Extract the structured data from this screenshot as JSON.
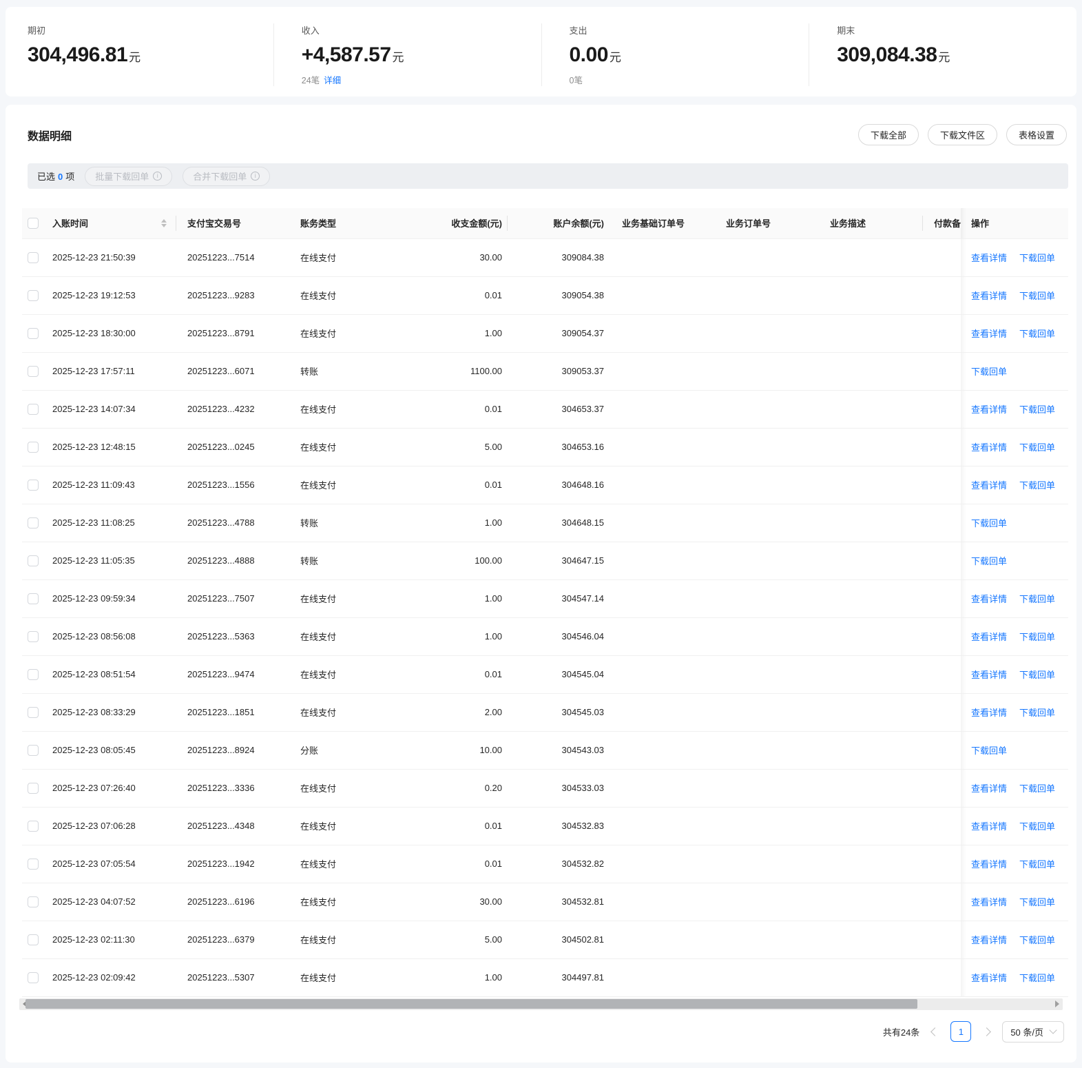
{
  "accent_color": "#1677ff",
  "summary": {
    "cards": [
      {
        "label": "期初",
        "value": "304,496.81",
        "unit": "元",
        "sub": "",
        "sub_link": ""
      },
      {
        "label": "收入",
        "value": "+4,587.57",
        "unit": "元",
        "sub": "24笔",
        "sub_link": "详细"
      },
      {
        "label": "支出",
        "value": "0.00",
        "unit": "元",
        "sub": "0笔",
        "sub_link": ""
      },
      {
        "label": "期末",
        "value": "309,084.38",
        "unit": "元",
        "sub": "",
        "sub_link": ""
      }
    ]
  },
  "panel": {
    "title": "数据明细",
    "buttons": {
      "download_all": "下载全部",
      "download_zone": "下载文件区",
      "table_settings": "表格设置"
    },
    "selection": {
      "prefix": "已选",
      "count": "0",
      "suffix": "项",
      "batch_download": "批量下载回单",
      "merge_download": "合并下载回单"
    }
  },
  "table": {
    "columns": [
      "入账时间",
      "支付宝交易号",
      "账务类型",
      "收支金额(元)",
      "账户余额(元)",
      "业务基础订单号",
      "业务订单号",
      "业务描述",
      "付款备",
      "操作"
    ],
    "actions": {
      "view": "查看详情",
      "download": "下载回单"
    },
    "rows": [
      {
        "time": "2025-12-23 21:50:39",
        "txn": "20251223...7514",
        "type": "在线支付",
        "amount": "30.00",
        "balance": "309084.38",
        "has_view": true
      },
      {
        "time": "2025-12-23 19:12:53",
        "txn": "20251223...9283",
        "type": "在线支付",
        "amount": "0.01",
        "balance": "309054.38",
        "has_view": true
      },
      {
        "time": "2025-12-23 18:30:00",
        "txn": "20251223...8791",
        "type": "在线支付",
        "amount": "1.00",
        "balance": "309054.37",
        "has_view": true
      },
      {
        "time": "2025-12-23 17:57:11",
        "txn": "20251223...6071",
        "type": "转账",
        "amount": "1100.00",
        "balance": "309053.37",
        "has_view": false
      },
      {
        "time": "2025-12-23 14:07:34",
        "txn": "20251223...4232",
        "type": "在线支付",
        "amount": "0.01",
        "balance": "304653.37",
        "has_view": true
      },
      {
        "time": "2025-12-23 12:48:15",
        "txn": "20251223...0245",
        "type": "在线支付",
        "amount": "5.00",
        "balance": "304653.16",
        "has_view": true
      },
      {
        "time": "2025-12-23 11:09:43",
        "txn": "20251223...1556",
        "type": "在线支付",
        "amount": "0.01",
        "balance": "304648.16",
        "has_view": true
      },
      {
        "time": "2025-12-23 11:08:25",
        "txn": "20251223...4788",
        "type": "转账",
        "amount": "1.00",
        "balance": "304648.15",
        "has_view": false
      },
      {
        "time": "2025-12-23 11:05:35",
        "txn": "20251223...4888",
        "type": "转账",
        "amount": "100.00",
        "balance": "304647.15",
        "has_view": false
      },
      {
        "time": "2025-12-23 09:59:34",
        "txn": "20251223...7507",
        "type": "在线支付",
        "amount": "1.00",
        "balance": "304547.14",
        "has_view": true
      },
      {
        "time": "2025-12-23 08:56:08",
        "txn": "20251223...5363",
        "type": "在线支付",
        "amount": "1.00",
        "balance": "304546.04",
        "has_view": true
      },
      {
        "time": "2025-12-23 08:51:54",
        "txn": "20251223...9474",
        "type": "在线支付",
        "amount": "0.01",
        "balance": "304545.04",
        "has_view": true
      },
      {
        "time": "2025-12-23 08:33:29",
        "txn": "20251223...1851",
        "type": "在线支付",
        "amount": "2.00",
        "balance": "304545.03",
        "has_view": true
      },
      {
        "time": "2025-12-23 08:05:45",
        "txn": "20251223...8924",
        "type": "分账",
        "amount": "10.00",
        "balance": "304543.03",
        "has_view": false
      },
      {
        "time": "2025-12-23 07:26:40",
        "txn": "20251223...3336",
        "type": "在线支付",
        "amount": "0.20",
        "balance": "304533.03",
        "has_view": true
      },
      {
        "time": "2025-12-23 07:06:28",
        "txn": "20251223...4348",
        "type": "在线支付",
        "amount": "0.01",
        "balance": "304532.83",
        "has_view": true
      },
      {
        "time": "2025-12-23 07:05:54",
        "txn": "20251223...1942",
        "type": "在线支付",
        "amount": "0.01",
        "balance": "304532.82",
        "has_view": true
      },
      {
        "time": "2025-12-23 04:07:52",
        "txn": "20251223...6196",
        "type": "在线支付",
        "amount": "30.00",
        "balance": "304532.81",
        "has_view": true
      },
      {
        "time": "2025-12-23 02:11:30",
        "txn": "20251223...6379",
        "type": "在线支付",
        "amount": "5.00",
        "balance": "304502.81",
        "has_view": true
      },
      {
        "time": "2025-12-23 02:09:42",
        "txn": "20251223...5307",
        "type": "在线支付",
        "amount": "1.00",
        "balance": "304497.81",
        "has_view": true
      }
    ]
  },
  "pagination": {
    "total": "共有24条",
    "current_page": "1",
    "page_size": "50 条/页"
  }
}
